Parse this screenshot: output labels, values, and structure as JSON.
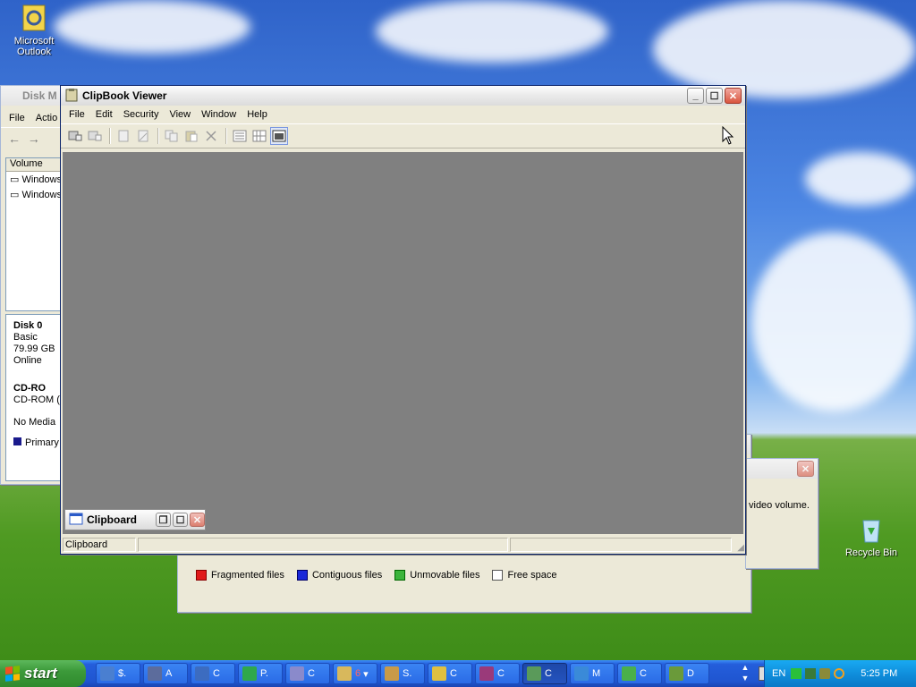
{
  "desktop": {
    "icons": [
      {
        "label": "Microsoft Outlook"
      },
      {
        "label": "Recycle Bin"
      }
    ]
  },
  "disk_mgmt": {
    "title": "Disk M",
    "menu": [
      "File",
      "Actio"
    ],
    "columns": [
      "Volume"
    ],
    "volumes": [
      "Windows",
      "Windows"
    ],
    "disk0": {
      "name": "Disk 0",
      "type": "Basic",
      "size": "79.99 GB",
      "status": "Online"
    },
    "cdrom": {
      "name": "CD-RO",
      "sub": "CD-ROM (D",
      "status": "No Media"
    },
    "legend": "Primary p"
  },
  "clipbook": {
    "title": "ClipBook Viewer",
    "menu": [
      "File",
      "Edit",
      "Security",
      "View",
      "Window",
      "Help"
    ],
    "child_title": "Clipboard",
    "status_text": "Clipboard"
  },
  "defrag": {
    "legend": [
      {
        "label": "Fragmented files",
        "color": "#e01a1a"
      },
      {
        "label": "Contiguous files",
        "color": "#1a28d8"
      },
      {
        "label": "Unmovable files",
        "color": "#3cb43c"
      },
      {
        "label": "Free space",
        "color": "#ffffff"
      }
    ]
  },
  "dialog": {
    "text": "video volume."
  },
  "taskbar": {
    "start_label": "start",
    "tasks": [
      {
        "label": "$.",
        "icon_color": "#4a7fd0"
      },
      {
        "label": "A",
        "icon_color": "#5c6c9c"
      },
      {
        "label": "C",
        "icon_color": "#3c6cc0"
      },
      {
        "label": "P.",
        "icon_color": "#2fa84a"
      },
      {
        "label": "C",
        "icon_color": "#8a8acb"
      },
      {
        "label": "6",
        "icon_color": "#d8b85c"
      },
      {
        "label": "S.",
        "icon_color": "#c89a48"
      },
      {
        "label": "C",
        "icon_color": "#e0c040"
      },
      {
        "label": "C",
        "icon_color": "#9a3a7a"
      },
      {
        "label": "C",
        "icon_color": "#5a9a5a"
      },
      {
        "label": "M",
        "icon_color": "#3a8ad8"
      },
      {
        "label": "C",
        "icon_color": "#4ab04a"
      },
      {
        "label": "D",
        "icon_color": "#6a9a3a"
      }
    ],
    "tray": {
      "lang": "EN",
      "time": "5:25 PM"
    }
  }
}
